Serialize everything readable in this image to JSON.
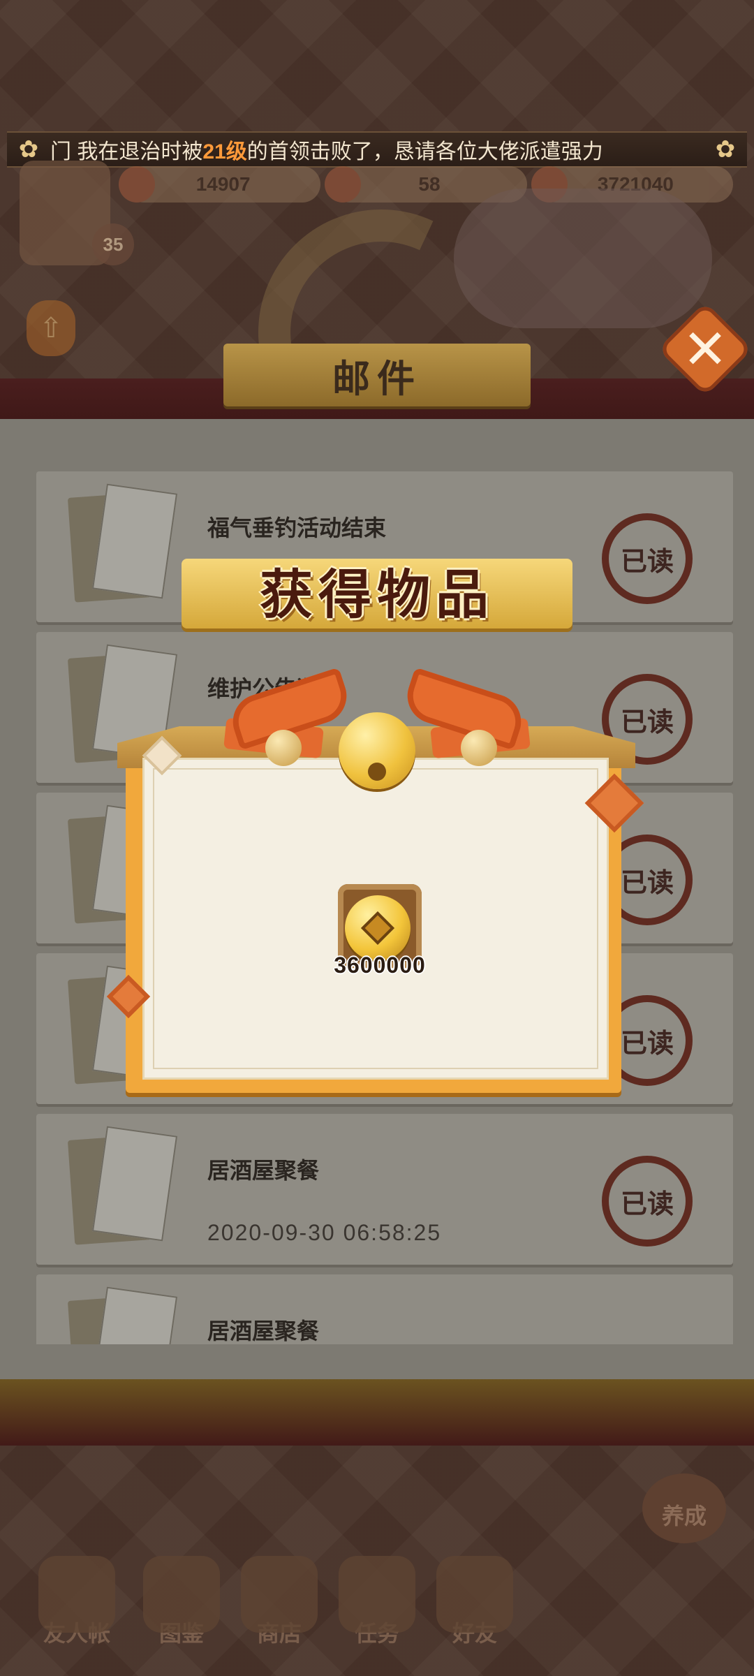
{
  "ticker": {
    "pre": "门 我在退治时被",
    "level": "21级",
    "post": "的首领击败了，恳请各位大佬派遣强力"
  },
  "hud": {
    "res1": "14907",
    "res2": "58",
    "res3": "3721040",
    "player_level": "35"
  },
  "page_title": "邮件",
  "close_label": "✕",
  "mails": [
    {
      "subject": "福气垂钓活动结束",
      "date": "",
      "status": "已读"
    },
    {
      "subject": "维护公告通知",
      "date": "",
      "status": "已读"
    },
    {
      "subject": "",
      "date": "",
      "status": "已读"
    },
    {
      "subject": "",
      "date": "",
      "status": "已读"
    },
    {
      "subject": "居酒屋聚餐",
      "date": "2020-09-30 06:58:25",
      "status": "已读"
    },
    {
      "subject": "居酒屋聚餐",
      "date": "",
      "status": ""
    }
  ],
  "reward": {
    "title": "获得物品",
    "items": [
      {
        "icon": "coin-icon",
        "count": "3600000"
      }
    ]
  },
  "bottom_nav": [
    {
      "label": "友人帐"
    },
    {
      "label": "图鉴"
    },
    {
      "label": "商店"
    },
    {
      "label": "任务"
    },
    {
      "label": "好友"
    }
  ],
  "cultivate_label": "养成"
}
